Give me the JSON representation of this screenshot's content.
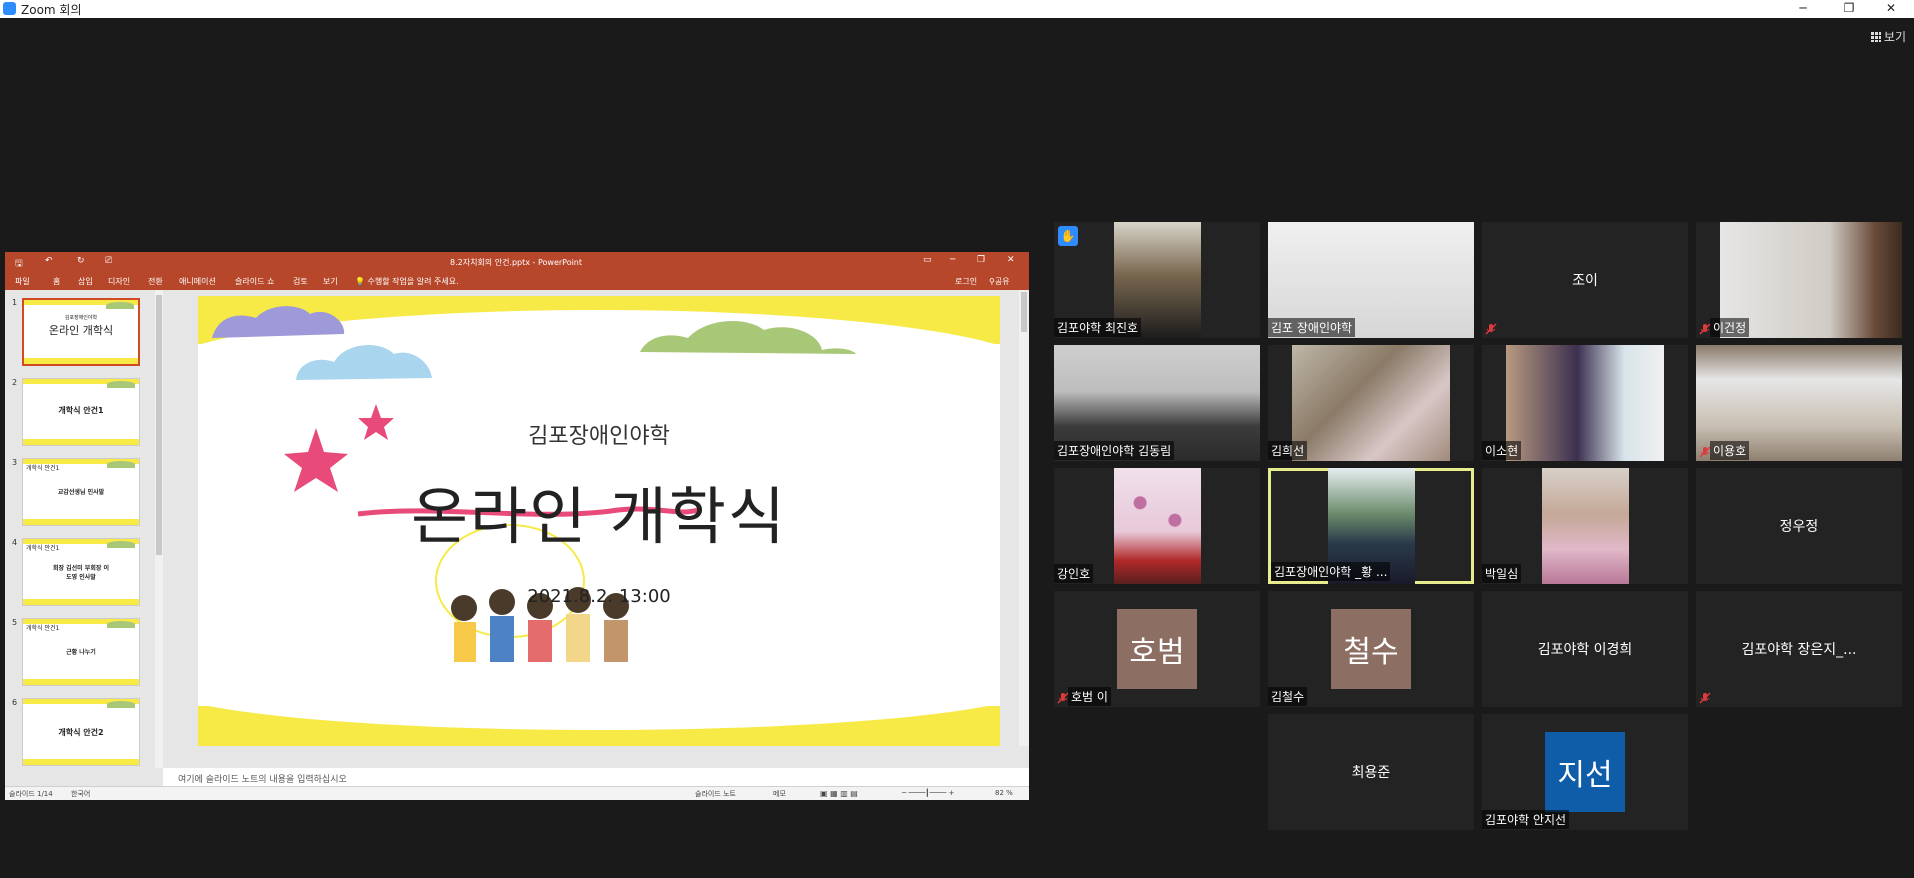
{
  "window": {
    "title": "Zoom 회의",
    "minimize": "─",
    "restore": "❐",
    "close": "✕"
  },
  "view_button": {
    "label": "보기",
    "icon": "grid-icon"
  },
  "ppt": {
    "doc_title": "8.2자치회의 안건.pptx - PowerPoint",
    "tabs": [
      "파일",
      "홈",
      "삽입",
      "디자인",
      "전환",
      "애니메이션",
      "슬라이드 쇼",
      "검토",
      "보기"
    ],
    "tell_me": "수행할 작업을 알려 주세요.",
    "login": "로그인",
    "share": "공유",
    "slides": [
      {
        "num": "1",
        "label": "온라인 개학식",
        "tag": "김포장애인야학"
      },
      {
        "num": "2",
        "label": "개학식 안건1",
        "tag": ""
      },
      {
        "num": "3",
        "label": "교감선생님 인사말",
        "tag": "개학식 안건1"
      },
      {
        "num": "4",
        "label": "회장 김선미 부회장 이도영 인사말",
        "tag": "개학식 안건1"
      },
      {
        "num": "5",
        "label": "근황 나누기",
        "tag": "개학식 안건1"
      },
      {
        "num": "6",
        "label": "개학식 안건2",
        "tag": ""
      },
      {
        "num": "7",
        "label": "",
        "tag": ""
      }
    ],
    "slide": {
      "subtitle": "김포장애인야학",
      "title": "온라인 개학식",
      "date": "2021.8.2. 13:00"
    },
    "notes_placeholder": "여기에 슬라이드 노트의 내용을 입력하십시오",
    "status": {
      "slide": "슬라이드 1/14",
      "lang": "한국어",
      "notes": "슬라이드 노트",
      "comments": "메모",
      "zoom": "82 %"
    }
  },
  "participants": [
    {
      "name": "김포야학 최진호",
      "muted": false,
      "hand": true,
      "type": "video"
    },
    {
      "name": "김포 장애인야학",
      "muted": false,
      "hand": false,
      "type": "video"
    },
    {
      "name": "조이",
      "muted": true,
      "hand": false,
      "type": "name"
    },
    {
      "name": "이건정",
      "muted": true,
      "hand": false,
      "type": "video"
    },
    {
      "name": "김포장애인야학 김동림",
      "muted": false,
      "hand": false,
      "type": "video"
    },
    {
      "name": "김희선",
      "muted": false,
      "hand": false,
      "type": "video"
    },
    {
      "name": "이소현",
      "muted": false,
      "hand": false,
      "type": "video"
    },
    {
      "name": "이용호",
      "muted": true,
      "hand": false,
      "type": "video"
    },
    {
      "name": "강인호",
      "muted": false,
      "hand": false,
      "type": "video"
    },
    {
      "name": "김포장애인야학 _황 ...",
      "muted": false,
      "hand": false,
      "type": "video",
      "active": true
    },
    {
      "name": "박일심",
      "muted": false,
      "hand": false,
      "type": "video"
    },
    {
      "name": "정우정",
      "muted": false,
      "hand": false,
      "type": "name"
    },
    {
      "name": "호범 이",
      "muted": true,
      "hand": false,
      "type": "avatar",
      "avatar_text": "호범",
      "avatar_color": "#8d6e63"
    },
    {
      "name": "김철수",
      "muted": false,
      "hand": false,
      "type": "avatar",
      "avatar_text": "철수",
      "avatar_color": "#8d6e63"
    },
    {
      "name": "김포야학 이경희",
      "muted": false,
      "hand": false,
      "type": "name"
    },
    {
      "name": "김포야학 장은지_...",
      "muted": true,
      "hand": false,
      "type": "name"
    },
    {
      "name": "최용준",
      "muted": false,
      "hand": false,
      "type": "name"
    },
    {
      "name": "김포야학 안지선",
      "muted": false,
      "hand": false,
      "type": "avatar",
      "avatar_text": "지선",
      "avatar_color": "#0f5ca8"
    }
  ],
  "colors": {
    "ppt_brand": "#b7472a",
    "zoom_blue": "#2d8cff",
    "active_speaker": "#e7ec8d",
    "slide_yellow": "#f7ea47",
    "muted_red": "#e0393e"
  }
}
